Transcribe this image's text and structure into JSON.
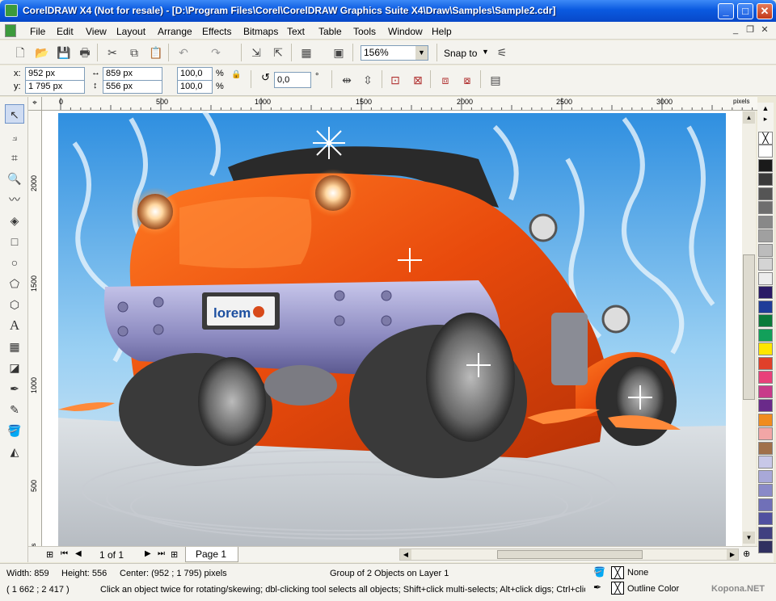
{
  "title": "CorelDRAW X4 (Not for resale) - [D:\\Program Files\\Corel\\CorelDRAW Graphics Suite X4\\Draw\\Samples\\Sample2.cdr]",
  "menu": [
    "File",
    "Edit",
    "View",
    "Layout",
    "Arrange",
    "Effects",
    "Bitmaps",
    "Text",
    "Table",
    "Tools",
    "Window",
    "Help"
  ],
  "standard": {
    "zoom": "156%",
    "snap_label": "Snap to"
  },
  "property": {
    "x_label": "x:",
    "x_value": "952 px",
    "y_label": "y:",
    "y_value": "1 795 px",
    "width_value": "859 px",
    "height_value": "556 px",
    "scale_x": "100,0",
    "scale_y": "100,0",
    "pct": "%",
    "rotation": "0,0",
    "degree": "°"
  },
  "ruler": {
    "h_ticks": [
      "0",
      "500",
      "1000",
      "1500",
      "2000",
      "2500",
      "3000"
    ],
    "v_ticks": [
      "2000",
      "1500",
      "1000",
      "500"
    ],
    "units": "pixels"
  },
  "canvas": {
    "plate_text": "lorem"
  },
  "page": {
    "counter": "1 of 1",
    "tab": "Page 1"
  },
  "status": {
    "width": "Width: 859",
    "height": "Height: 556",
    "center": "Center: (952  ; 1 795)  pixels",
    "object": "Group of 2 Objects on Layer 1",
    "coords": "( 1 662 ; 2 417 )",
    "hint": "Click an object twice for rotating/skewing; dbl-clicking tool selects all objects; Shift+click multi-selects; Alt+click digs; Ctrl+click...",
    "fill": "None",
    "outline": "Outline Color",
    "watermark": "Kopona.NET"
  },
  "palette": [
    "#ffffff",
    "#1a1a1a",
    "#3a3a3a",
    "#555555",
    "#6e6e6e",
    "#888888",
    "#a0a0a0",
    "#bcbcbc",
    "#d4d4d4",
    "#ececec",
    "#2a1a66",
    "#1f3d99",
    "#0a7a3a",
    "#12a05a",
    "#ffe600",
    "#e0402a",
    "#e8407a",
    "#c83a8a",
    "#6a2a8a",
    "#f08c1e",
    "#f2a6a6",
    "#a0704a",
    "#c8c8e8",
    "#a8a8d8",
    "#8a8ac8",
    "#7070b8",
    "#5050a0",
    "#404080",
    "#303060"
  ]
}
